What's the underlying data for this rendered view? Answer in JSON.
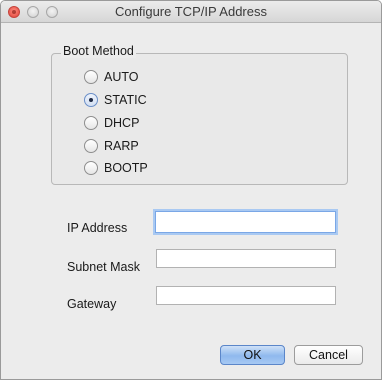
{
  "window": {
    "title": "Configure TCP/IP Address"
  },
  "boot_method": {
    "group_label": "Boot Method",
    "options": [
      {
        "label": "AUTO",
        "selected": false
      },
      {
        "label": "STATIC",
        "selected": true
      },
      {
        "label": "DHCP",
        "selected": false
      },
      {
        "label": "RARP",
        "selected": false
      },
      {
        "label": "BOOTP",
        "selected": false
      }
    ]
  },
  "fields": {
    "ip_address": {
      "label": "IP Address",
      "value": ""
    },
    "subnet_mask": {
      "label": "Subnet Mask",
      "value": ""
    },
    "gateway": {
      "label": "Gateway",
      "value": ""
    }
  },
  "buttons": {
    "ok": "OK",
    "cancel": "Cancel"
  },
  "colors": {
    "default_button": "#8fb9ee",
    "focus_ring": "#a9c9f2",
    "close_button": "#e0443a"
  }
}
